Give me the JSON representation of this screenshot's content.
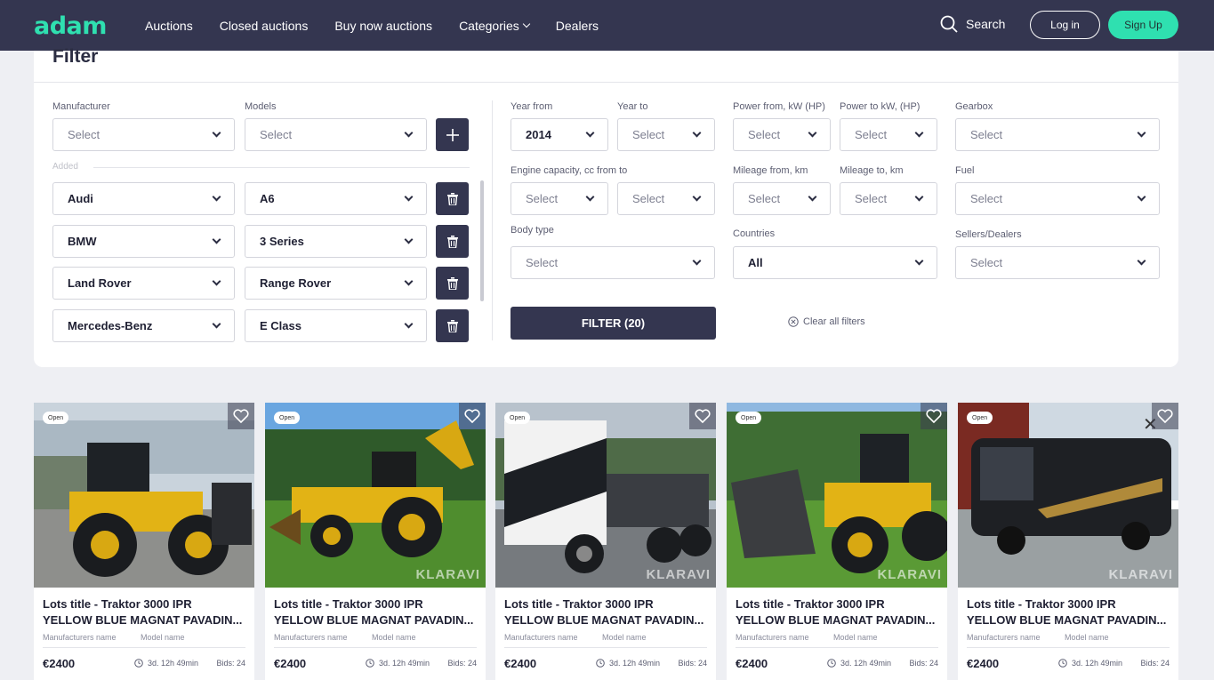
{
  "header": {
    "logo": "adam",
    "nav": [
      "Auctions",
      "Closed auctions",
      "Buy now auctions",
      "Categories",
      "Dealers"
    ],
    "search_label": "Search",
    "login_label": "Log in",
    "signup_label": "Sign Up"
  },
  "filter": {
    "title": "Filter",
    "manufacturer_label": "Manufacturer",
    "models_label": "Models",
    "manufacturer_placeholder": "Select",
    "models_placeholder": "Select",
    "added_label": "Added",
    "added": [
      {
        "manufacturer": "Audi",
        "model": "A6"
      },
      {
        "manufacturer": "BMW",
        "model": "3 Series"
      },
      {
        "manufacturer": "Land Rover",
        "model": "Range Rover"
      },
      {
        "manufacturer": "Mercedes-Benz",
        "model": "E Class"
      }
    ],
    "year_from_label": "Year from",
    "year_from_value": "2014",
    "year_to_label": "Year to",
    "year_to_value": "Select",
    "power_from_label": "Power from, kW (HP)",
    "power_from_value": "Select",
    "power_to_label": "Power to kW, (HP)",
    "power_to_value": "Select",
    "gearbox_label": "Gearbox",
    "gearbox_value": "Select",
    "engine_label": "Engine capacity, cc from to",
    "engine_from_value": "Select",
    "engine_to_value": "Select",
    "mileage_from_label": "Mileage from, km",
    "mileage_from_value": "Select",
    "mileage_to_label": "Mileage to, km",
    "mileage_to_value": "Select",
    "fuel_label": "Fuel",
    "fuel_value": "Select",
    "body_label": "Body type",
    "body_value": "Select",
    "countries_label": "Countries",
    "countries_value": "All",
    "sellers_label": "Sellers/Dealers",
    "sellers_value": "Select",
    "filter_button": "FILTER (20)",
    "clear_label": "Clear all filters"
  },
  "cards": [
    {
      "badge": "Open",
      "title1": "Lots title - Traktor 3000 IPR",
      "title2": "YELLOW BLUE MAGNAT PAVADIN...",
      "manufacturer": "Manufacturers name",
      "model": "Model name",
      "price": "€2400",
      "time": "3d. 12h 49min",
      "bids": "Bids: 24",
      "watermark": ""
    },
    {
      "badge": "Open",
      "title1": "Lots title - Traktor 3000 IPR",
      "title2": "YELLOW BLUE MAGNAT PAVADIN...",
      "manufacturer": "Manufacturers name",
      "model": "Model name",
      "price": "€2400",
      "time": "3d. 12h 49min",
      "bids": "Bids: 24",
      "watermark": "KLARAVI"
    },
    {
      "badge": "Open",
      "title1": "Lots title - Traktor 3000 IPR",
      "title2": "YELLOW BLUE MAGNAT PAVADIN...",
      "manufacturer": "Manufacturers name",
      "model": "Model name",
      "price": "€2400",
      "time": "3d. 12h 49min",
      "bids": "Bids: 24",
      "watermark": "KLARAVI"
    },
    {
      "badge": "Open",
      "title1": "Lots title - Traktor 3000 IPR",
      "title2": "YELLOW BLUE MAGNAT PAVADIN...",
      "manufacturer": "Manufacturers name",
      "model": "Model name",
      "price": "€2400",
      "time": "3d. 12h 49min",
      "bids": "Bids: 24",
      "watermark": "KLARAVI"
    },
    {
      "badge": "Open",
      "title1": "Lots title - Traktor 3000 IPR",
      "title2": "YELLOW BLUE MAGNAT PAVADIN...",
      "manufacturer": "Manufacturers name",
      "model": "Model name",
      "price": "€2400",
      "time": "3d. 12h 49min",
      "bids": "Bids: 24",
      "watermark": "KLARAVI"
    }
  ]
}
